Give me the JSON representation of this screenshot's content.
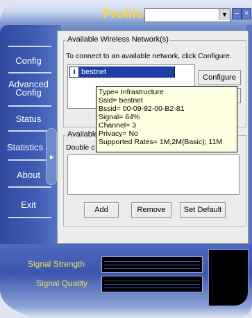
{
  "window": {
    "title": "Profile",
    "profile_value": "",
    "minimize_label": "–",
    "close_label": "×"
  },
  "nav": [
    {
      "label": "Config"
    },
    {
      "label": "Advanced\nConfig"
    },
    {
      "label": "Status"
    },
    {
      "label": "Statistics"
    },
    {
      "label": "About"
    },
    {
      "label": "Exit"
    }
  ],
  "available": {
    "group_title": "Available Wireless Network(s)",
    "hint": "To connect to an available network, click Configure.",
    "networks": [
      {
        "ssid": "bestnet",
        "icon": "user-icon"
      }
    ],
    "configure_label": "Configure"
  },
  "preferred": {
    "group_title": "Available",
    "hint": "Double c",
    "add_label": "Add",
    "remove_label": "Remove",
    "default_label": "Set Default"
  },
  "tooltip": {
    "lines": [
      "Type= Infrastructure",
      "Ssid= bestnet",
      "Bssid= 00-09-92-00-B2-81",
      "Signal= 64%",
      "Channel= 3",
      "Privacy= No",
      "Supported Rates= 1M,2M(Basic); 11M"
    ]
  },
  "signal": {
    "strength_label": "Signal Strength",
    "quality_label": "Signal Quality",
    "strength_fraction": 0,
    "quality_fraction": 0
  },
  "colors": {
    "title": "#ffd33a",
    "signal_label": "#f2e35a",
    "nav_text": "#ffffff",
    "selection": "#1f3fa8"
  }
}
